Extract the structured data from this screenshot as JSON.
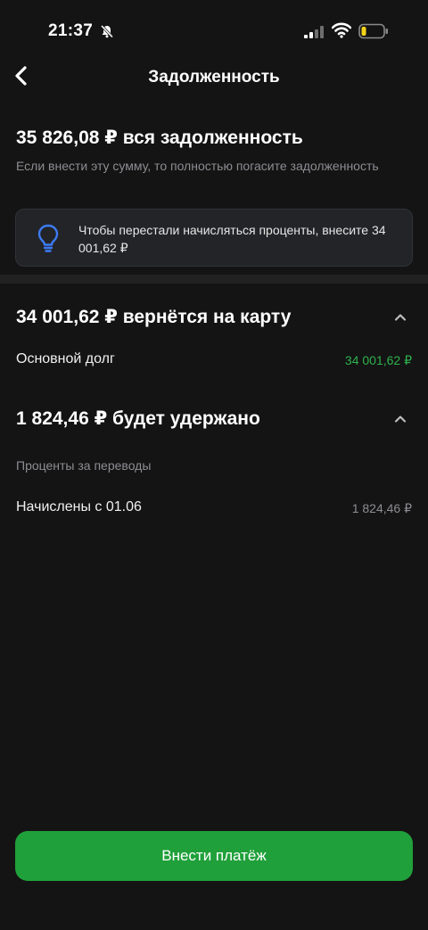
{
  "status_bar": {
    "time": "21:37"
  },
  "header": {
    "title": "Задолженность"
  },
  "summary": {
    "total": "35 826,08 ₽ вся задолженность",
    "hint": "Если внести эту сумму, то полностью погасите задолженность"
  },
  "info_card": {
    "text": "Чтобы перестали начисляться проценты, внесите 34 001,62 ₽"
  },
  "refund_section": {
    "title": "34 001,62 ₽ вернётся на карту",
    "rows": [
      {
        "label": "Основной долг",
        "value": "34 001,62 ₽"
      }
    ]
  },
  "withhold_section": {
    "title": "1 824,46 ₽ будет удержано",
    "subheader": "Проценты за переводы",
    "rows": [
      {
        "label": "Начислены с 01.06",
        "value": "1 824,46 ₽"
      }
    ]
  },
  "actions": {
    "pay_label": "Внести платёж"
  },
  "colors": {
    "background": "#141414",
    "accent_green": "#20a03a",
    "positive_value": "#2fb24c",
    "muted_text": "#8d8d93",
    "info_icon": "#3d7bf5"
  }
}
